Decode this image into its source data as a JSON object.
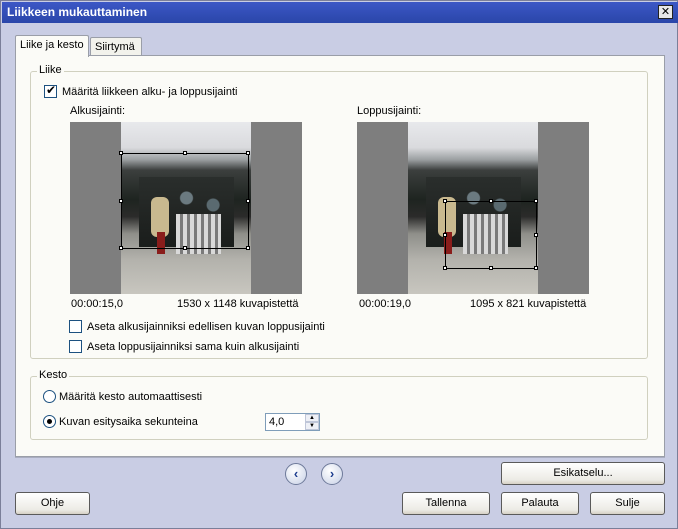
{
  "window": {
    "title": "Liikkeen mukauttaminen",
    "close_label": "✕"
  },
  "tabs": [
    {
      "label": "Liike ja kesto",
      "active": true
    },
    {
      "label": "Siirtymä",
      "active": false
    }
  ],
  "motion": {
    "group_label": "Liike",
    "define_checkbox_label": "Määritä liikkeen alku- ja loppusijainti",
    "define_checked": true,
    "start": {
      "label": "Alkusijainti:",
      "time": "00:00:15,0",
      "dims": "1530 x 1148 kuvapistettä"
    },
    "end": {
      "label": "Loppusijainti:",
      "time": "00:00:19,0",
      "dims": "1095 x 821 kuvapistettä"
    },
    "opt_prev_end": "Aseta alkusijainniksi edellisen kuvan loppusijainti",
    "opt_same_as_start": "Aseta loppusijainniksi sama kuin alkusijainti"
  },
  "duration": {
    "group_label": "Kesto",
    "auto_label": "Määritä kesto automaattisesti",
    "seconds_label": "Kuvan esitysaika sekunteina",
    "seconds_value": "4,0",
    "selected": "seconds"
  },
  "buttons": {
    "preview": "Esikatselu...",
    "help": "Ohje",
    "save": "Tallenna",
    "revert": "Palauta",
    "close": "Sulje"
  },
  "icons": {
    "prev": "arrow-left-icon",
    "next": "arrow-right-icon",
    "check": "checkmark-icon"
  }
}
